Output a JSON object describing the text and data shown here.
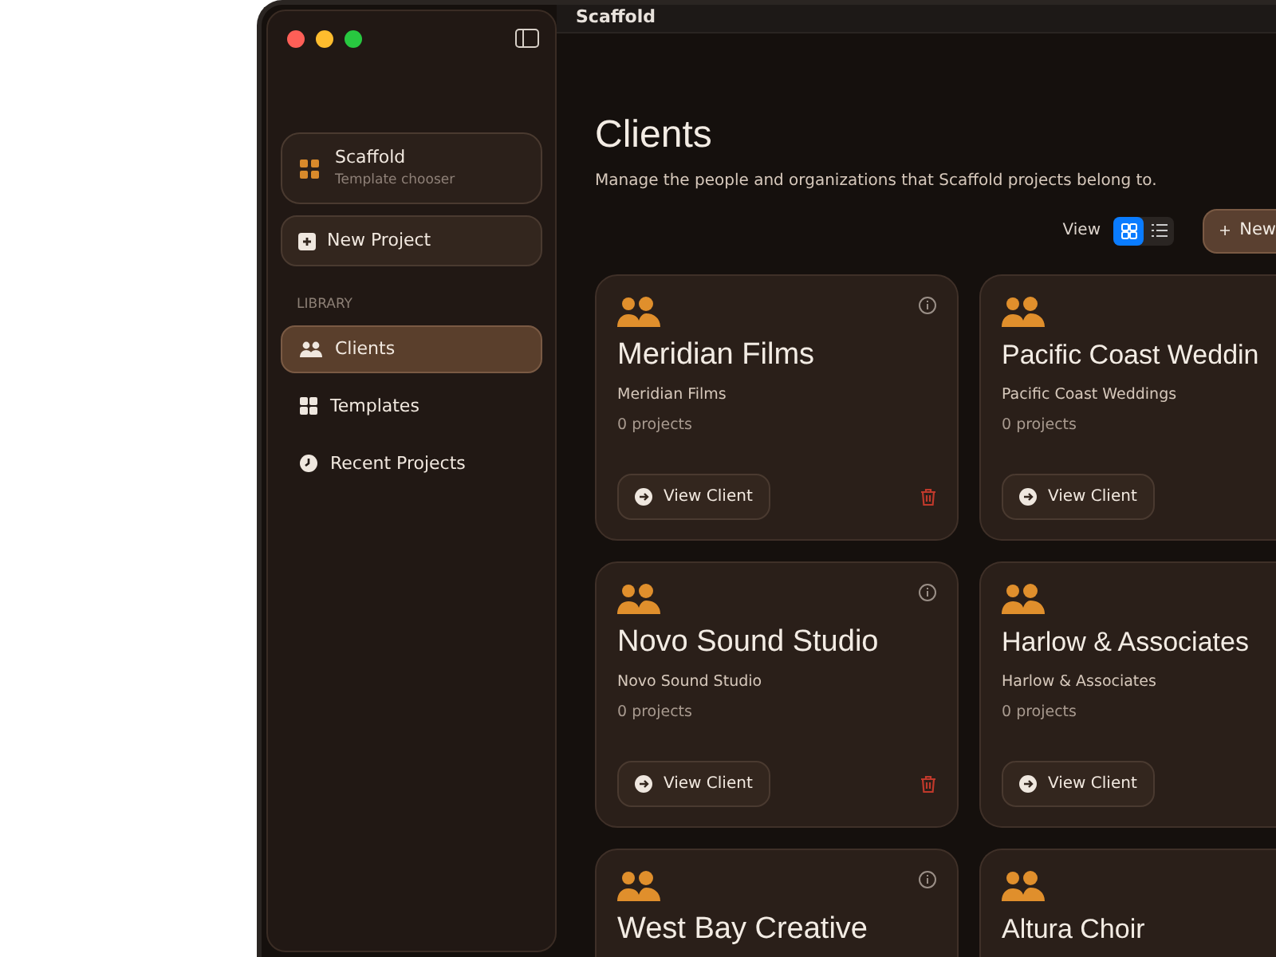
{
  "sidebar": {
    "brand": {
      "title": "Scaffold",
      "subtitle": "Template chooser"
    },
    "new_project": "New Project",
    "section": "LIBRARY",
    "items": [
      {
        "label": "Clients",
        "kind": "people",
        "selected": true
      },
      {
        "label": "Templates",
        "kind": "grid",
        "selected": false
      },
      {
        "label": "Recent Projects",
        "kind": "clock",
        "selected": false
      }
    ]
  },
  "toolbar": {
    "title": "Scaffold"
  },
  "page": {
    "title": "Clients",
    "subtitle": "Manage the people and organizations that Scaffold projects belong to.",
    "view_label": "View",
    "view_options": [
      {
        "kind": "grid",
        "selected": true
      },
      {
        "kind": "list",
        "selected": false
      }
    ],
    "new_button": "New"
  },
  "clients": [
    {
      "name": "Meridian Films",
      "organization": "Meridian Films",
      "projects": "0 projects",
      "action": "View Client"
    },
    {
      "name": "Pacific Coast Weddin",
      "organization": "Pacific Coast Weddings",
      "projects": "0 projects",
      "action": "View Client"
    },
    {
      "name": "Novo Sound Studio",
      "organization": "Novo Sound Studio",
      "projects": "0 projects",
      "action": "View Client"
    },
    {
      "name": "Harlow & Associates",
      "organization": "Harlow & Associates",
      "projects": "0 projects",
      "action": "View Client"
    },
    {
      "name": "West Bay Creative"
    },
    {
      "name": "Altura Choir"
    }
  ]
}
